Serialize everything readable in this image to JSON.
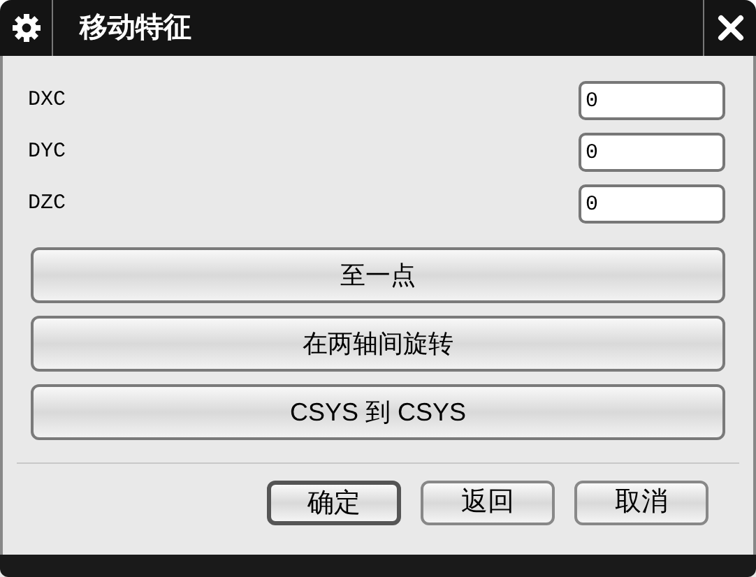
{
  "window": {
    "title": "移动特征"
  },
  "fields": [
    {
      "label": "DXC",
      "value": "0"
    },
    {
      "label": "DYC",
      "value": "0"
    },
    {
      "label": "DZC",
      "value": "0"
    }
  ],
  "actions": [
    "至一点",
    "在两轴间旋转",
    "CSYS 到 CSYS"
  ],
  "buttons": [
    {
      "label": "确定",
      "selected": true
    },
    {
      "label": "返回",
      "selected": false
    },
    {
      "label": "取消",
      "selected": false
    }
  ]
}
